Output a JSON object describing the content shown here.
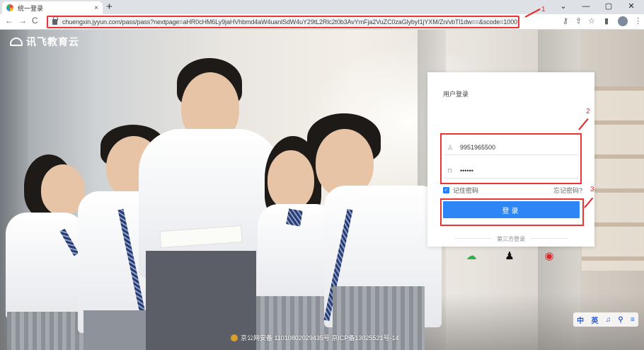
{
  "browser": {
    "tab_title": "统一登录",
    "tab_close": "×",
    "new_tab": "+",
    "window_controls": [
      "⌄",
      "—",
      "▢",
      "✕"
    ],
    "nav": [
      "←",
      "→",
      "C"
    ],
    "url": "chuengxin.jyyun.com/pass/pass?nextpage=aHR0cHM6Ly9jaHVhbmd4aW4uanlSdW4uY29tL2Rlc2t0b3AvYmFja2VuZC0zaGlybyI1jYXM/Zn/vbTl1dw==&scode=1000",
    "toolbar_icons": [
      "⚷",
      "⇪",
      "☆",
      "▮",
      "⋮"
    ]
  },
  "annotations": [
    "1",
    "2",
    "3"
  ],
  "site": {
    "logo_text": "讯飞教育云"
  },
  "login": {
    "title": "用户登录",
    "username_value": "9951965500",
    "password_value": "••••••",
    "remember_label": "记住密码",
    "forgot_label": "忘记密码?",
    "submit_label": "登录",
    "third_party_label": "第三方登录",
    "social_icons": [
      "wechat-icon",
      "qq-icon",
      "weibo-icon"
    ]
  },
  "footer": {
    "text": "京公网安备 11010802029435号   京ICP备13025521号-14"
  },
  "bottom_tools": [
    "中",
    "英",
    "♫",
    "⚲",
    "≡"
  ],
  "colors": {
    "accent": "#2e86f6",
    "annotation": "#e22222"
  }
}
